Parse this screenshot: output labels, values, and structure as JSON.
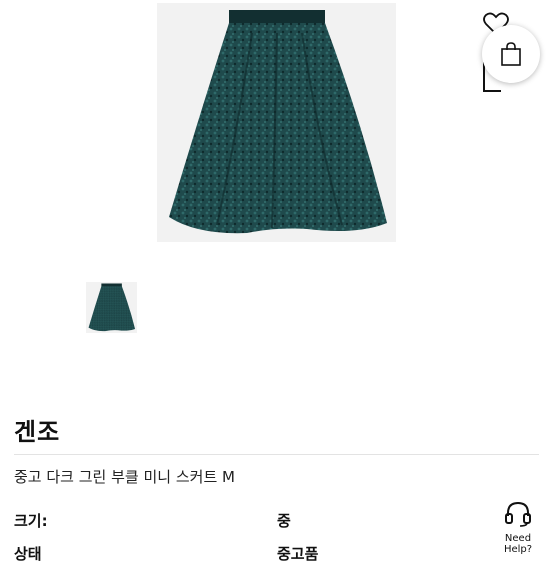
{
  "product": {
    "brand": "겐조",
    "title": "중고 다크 그린 부클 미니 스커트 M",
    "main_image_icon": "skirt-photo",
    "thumbnail_icon": "skirt-thumbnail"
  },
  "specs": [
    {
      "label": "크기:",
      "value": "중"
    },
    {
      "label": "상태",
      "value": "중고품"
    }
  ],
  "actions": {
    "wishlist_icon": "heart-icon",
    "bag_icon": "shopping-bag-icon"
  },
  "help": {
    "label": "Need Help?",
    "icon": "headset-icon"
  },
  "colors": {
    "skirt": "#1f4a4c",
    "skirt_dark": "#0f2a2c",
    "image_bg": "#f2f2f2"
  }
}
